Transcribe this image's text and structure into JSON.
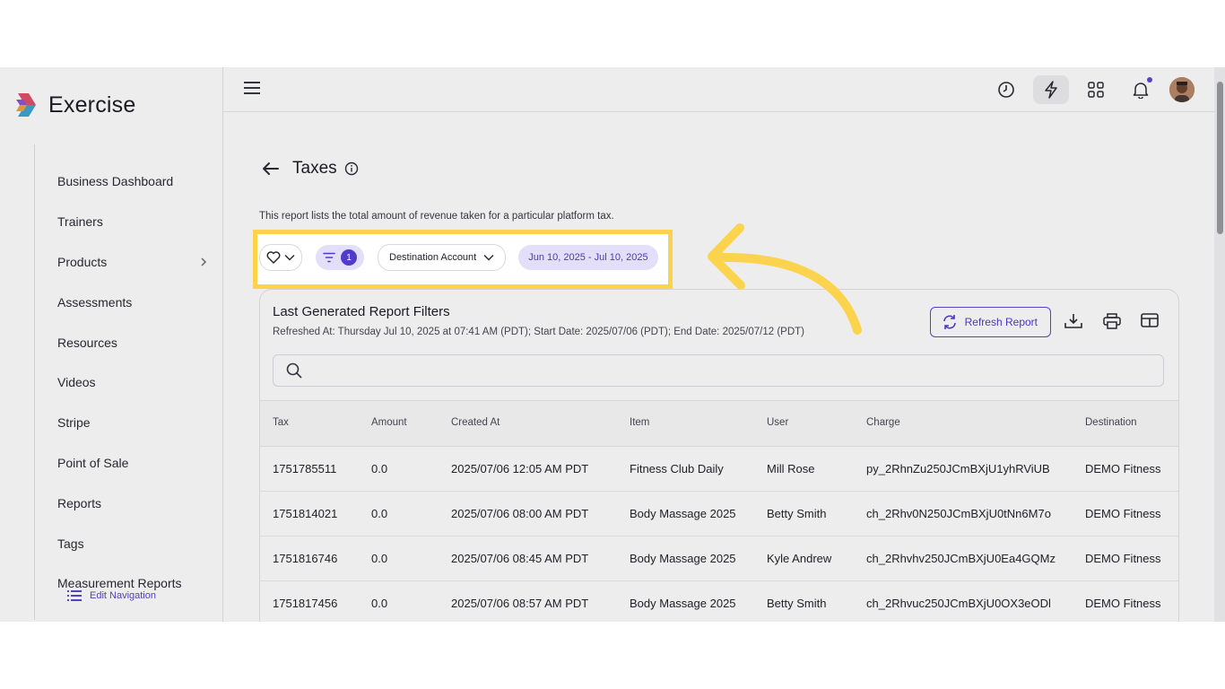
{
  "app": {
    "name": "Exercise"
  },
  "sidebar": {
    "items": [
      {
        "label": "Business Dashboard"
      },
      {
        "label": "Trainers"
      },
      {
        "label": "Products",
        "has_chevron": true
      },
      {
        "label": "Assessments"
      },
      {
        "label": "Resources"
      },
      {
        "label": "Videos"
      },
      {
        "label": "Stripe"
      },
      {
        "label": "Point of Sale"
      },
      {
        "label": "Reports"
      },
      {
        "label": "Tags"
      },
      {
        "label": "Measurement Reports"
      }
    ],
    "edit_nav_label": "Edit Navigation"
  },
  "topbar": {
    "icons": [
      "history-icon",
      "bolt-icon",
      "apps-grid-icon",
      "bell-icon"
    ],
    "notification_dot": true
  },
  "page": {
    "title": "Taxes",
    "description": "This report lists the total amount of revenue taken for a particular platform tax."
  },
  "filters": {
    "filter_count": "1",
    "destination_label": "Destination Account",
    "date_range": "Jun 10, 2025 - Jul 10, 2025"
  },
  "report": {
    "title": "Last Generated Report Filters",
    "subtitle": "Refreshed At: Thursday Jul 10, 2025 at 07:41 AM (PDT); Start Date: 2025/07/06 (PDT); End Date: 2025/07/12 (PDT)",
    "refresh_label": "Refresh Report",
    "search_placeholder": ""
  },
  "table": {
    "columns": [
      "Tax",
      "Amount",
      "Created At",
      "Item",
      "User",
      "Charge",
      "Destination"
    ],
    "rows": [
      [
        "1751785511",
        "0.0",
        "2025/07/06 12:05 AM PDT",
        "Fitness Club Daily",
        "Mill Rose",
        "py_2RhnZu250JCmBXjU1yhRViUB",
        "DEMO Fitness"
      ],
      [
        "1751814021",
        "0.0",
        "2025/07/06 08:00 AM PDT",
        "Body Massage 2025",
        "Betty Smith",
        "ch_2Rhv0N250JCmBXjU0tNn6M7o",
        "DEMO Fitness"
      ],
      [
        "1751816746",
        "0.0",
        "2025/07/06 08:45 AM PDT",
        "Body Massage 2025",
        "Kyle Andrew",
        "ch_2Rhvhv250JCmBXjU0Ea4GQMz",
        "DEMO Fitness"
      ],
      [
        "1751817456",
        "0.0",
        "2025/07/06 08:57 AM PDT",
        "Body Massage 2025",
        "Betty Smith",
        "ch_2Rhvuc250JCmBXjU0OX3eODl",
        "DEMO Fitness"
      ]
    ]
  },
  "colors": {
    "accent": "#4f3cc9",
    "accent_light": "#e3def9",
    "highlight": "#fcd34d"
  }
}
